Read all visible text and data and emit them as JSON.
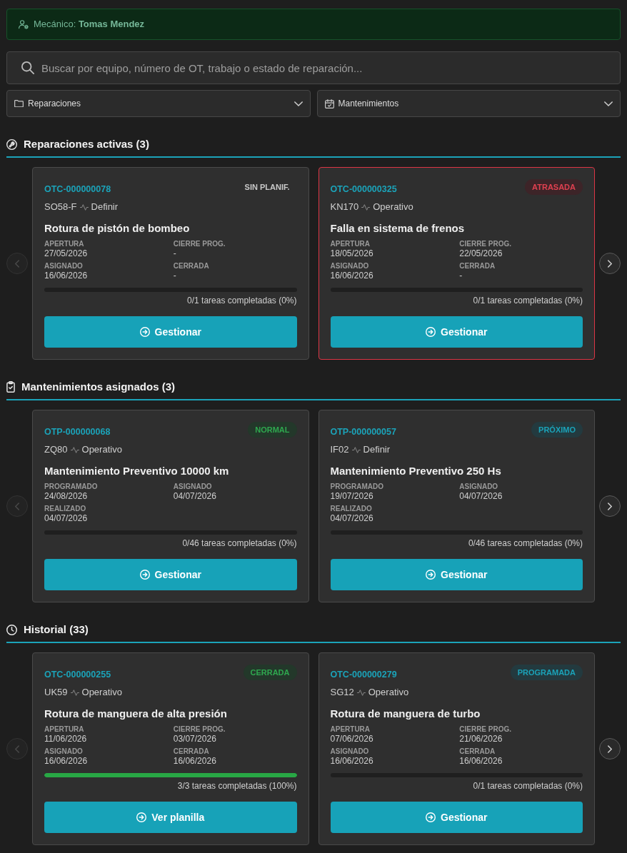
{
  "mechanic": {
    "text": "Mecánico: **Tomas Mendez**"
  },
  "search": {
    "placeholder": "Buscar por equipo, número de OT, trabajo o estado de reparación..."
  },
  "filters": [
    {
      "kind": "repairs",
      "label": "Reparaciones"
    },
    {
      "kind": "maintenance",
      "label": "Mantenimientos"
    }
  ],
  "sections": [
    {
      "kind": "repairs",
      "title": "Reparaciones activas (3)",
      "prev": {
        "disabled": true
      },
      "next": {
        "disabled": false
      },
      "cards": [
        {
          "number": "OTC-000000078",
          "badge": {
            "text": "SIN PLANIF.",
            "kind": "plain"
          },
          "equipment": "SO58-F",
          "status": "Definir",
          "title": "Rotura de pistón de bombeo",
          "fields": [
            {
              "label": "APERTURA",
              "value": "27/05/2026"
            },
            {
              "label": "CIERRE PROG.",
              "value": "-"
            },
            {
              "label": "ASIGNADO",
              "value": "16/06/2026"
            },
            {
              "label": "CERRADA",
              "value": "-"
            }
          ],
          "level": 0,
          "progress_text": "0/1 tareas completadas (0%)",
          "action": "Gestionar",
          "overdue": false
        },
        {
          "number": "OTC-000000325",
          "badge": {
            "text": "ATRASADA",
            "kind": "danger"
          },
          "equipment": "KN170",
          "status": "Operativo",
          "title": "Falla en sistema de frenos",
          "fields": [
            {
              "label": "APERTURA",
              "value": "18/05/2026"
            },
            {
              "label": "CIERRE PROG.",
              "value": "22/05/2026"
            },
            {
              "label": "ASIGNADO",
              "value": "16/06/2026"
            },
            {
              "label": "CERRADA",
              "value": "-"
            }
          ],
          "level": 0,
          "progress_text": "0/1 tareas completadas (0%)",
          "action": "Gestionar",
          "overdue": true
        }
      ]
    },
    {
      "kind": "maintenance",
      "title": "Mantenimientos asignados (3)",
      "prev": {
        "disabled": true
      },
      "next": {
        "disabled": false
      },
      "cards": [
        {
          "number": "OTP-000000068",
          "badge": {
            "text": "NORMAL",
            "kind": "success"
          },
          "equipment": "ZQ80",
          "status": "Operativo",
          "title": "Mantenimiento Preventivo 10000 km",
          "fields": [
            {
              "label": "PROGRAMADO",
              "value": "24/08/2026"
            },
            {
              "label": "ASIGNADO",
              "value": "04/07/2026"
            },
            {
              "label": "REALIZADO",
              "value": "04/07/2026"
            }
          ],
          "level": 0,
          "progress_text": "0/46 tareas completadas (0%)",
          "action": "Gestionar",
          "overdue": false
        },
        {
          "number": "OTP-000000057",
          "badge": {
            "text": "PRÓXIMO",
            "kind": "info"
          },
          "equipment": "IF02",
          "status": "Definir",
          "title": "Mantenimiento Preventivo 250 Hs",
          "fields": [
            {
              "label": "PROGRAMADO",
              "value": "19/07/2026"
            },
            {
              "label": "ASIGNADO",
              "value": "04/07/2026"
            },
            {
              "label": "REALIZADO",
              "value": "04/07/2026"
            }
          ],
          "level": 0,
          "progress_text": "0/46 tareas completadas (0%)",
          "action": "Gestionar",
          "overdue": false
        }
      ]
    },
    {
      "kind": "history",
      "title": "Historial (33)",
      "prev": {
        "disabled": true
      },
      "next": {
        "disabled": false
      },
      "cards": [
        {
          "number": "OTC-000000255",
          "badge": {
            "text": "CERRADA",
            "kind": "success"
          },
          "equipment": "UK59",
          "status": "Operativo",
          "title": "Rotura de manguera de alta presión",
          "fields": [
            {
              "label": "APERTURA",
              "value": "11/06/2026"
            },
            {
              "label": "CIERRE PROG.",
              "value": "03/07/2026"
            },
            {
              "label": "ASIGNADO",
              "value": "16/06/2026"
            },
            {
              "label": "CERRADA",
              "value": "16/06/2026"
            }
          ],
          "level": 1,
          "progress_text": "3/3 tareas completadas (100%)",
          "action": "Ver planilla",
          "overdue": false
        },
        {
          "number": "OTC-000000279",
          "badge": {
            "text": "PROGRAMADA",
            "kind": "info"
          },
          "equipment": "SG12",
          "status": "Operativo",
          "title": "Rotura de manguera de turbo",
          "fields": [
            {
              "label": "APERTURA",
              "value": "07/06/2026"
            },
            {
              "label": "CIERRE PROG.",
              "value": "21/06/2026"
            },
            {
              "label": "ASIGNADO",
              "value": "16/06/2026"
            },
            {
              "label": "CERRADA",
              "value": "16/06/2026"
            }
          ],
          "level": 0,
          "progress_text": "0/1 tareas completadas (0%)",
          "action": "Gestionar",
          "overdue": false
        }
      ]
    }
  ]
}
